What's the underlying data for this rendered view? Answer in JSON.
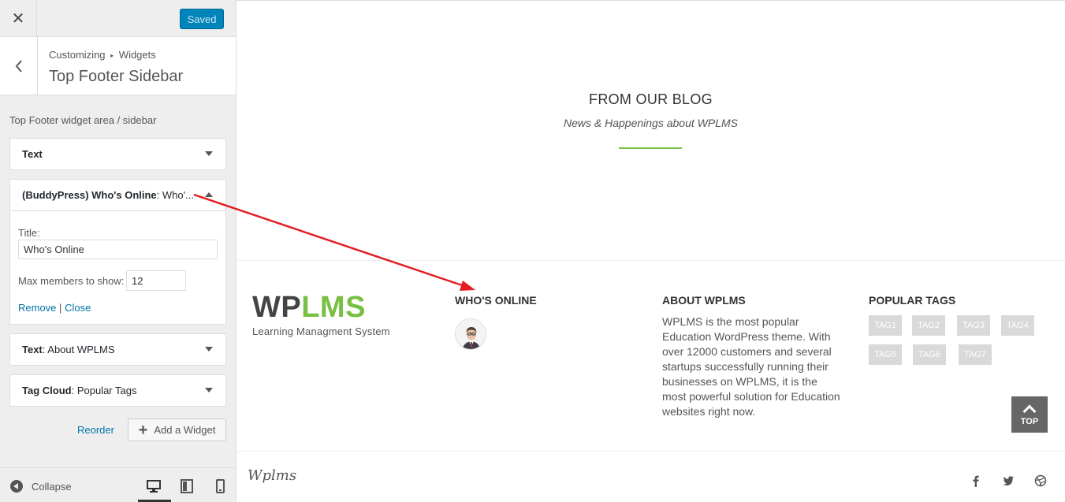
{
  "topbar": {
    "saved_label": "Saved"
  },
  "panel": {
    "breadcrumb_a": "Customizing",
    "breadcrumb_sep": "▸",
    "breadcrumb_b": "Widgets",
    "title": "Top Footer Sidebar",
    "area_description": "Top Footer widget area / sidebar"
  },
  "widgets": [
    {
      "type": "Text",
      "name": ""
    },
    {
      "type": "(BuddyPress) Who's Online",
      "name": ": Who'..."
    },
    {
      "type": "Text",
      "name": ": About WPLMS"
    },
    {
      "type": "Tag Cloud",
      "name": ": Popular Tags"
    }
  ],
  "online_form": {
    "title_label": "Title:",
    "title_value": "Who's Online",
    "max_label": "Max members to show:",
    "max_value": "12",
    "remove_label": "Remove",
    "sep": "|",
    "close_label": "Close"
  },
  "actions": {
    "reorder_label": "Reorder",
    "add_label": "Add a Widget"
  },
  "bottombar": {
    "collapse_label": "Collapse"
  },
  "preview": {
    "blog_title": "FROM OUR BLOG",
    "blog_subtitle": "News & Happenings about WPLMS",
    "logo_wp": "WP",
    "logo_lms": "LMS",
    "logo_tagline": "Learning Managment System",
    "who_title": "WHO'S ONLINE",
    "about_title": "ABOUT WPLMS",
    "about_text": "WPLMS is the most popular Education WordPress theme. With over 12000 customers and several startups successfully running their businesses on WPLMS, it is the most powerful solution for Education websites right now.",
    "tags_title": "POPULAR TAGS",
    "tags": [
      "TAG1",
      "TAG2",
      "TAG3",
      "TAG4",
      "TAG5",
      "TAG6",
      "TAG7"
    ],
    "top_label": "TOP",
    "signature": "Wplms"
  },
  "colors": {
    "accent": "#78c043",
    "primary_button": "#0085ba",
    "link": "#0073aa",
    "annotation_arrow": "#e31e24"
  }
}
